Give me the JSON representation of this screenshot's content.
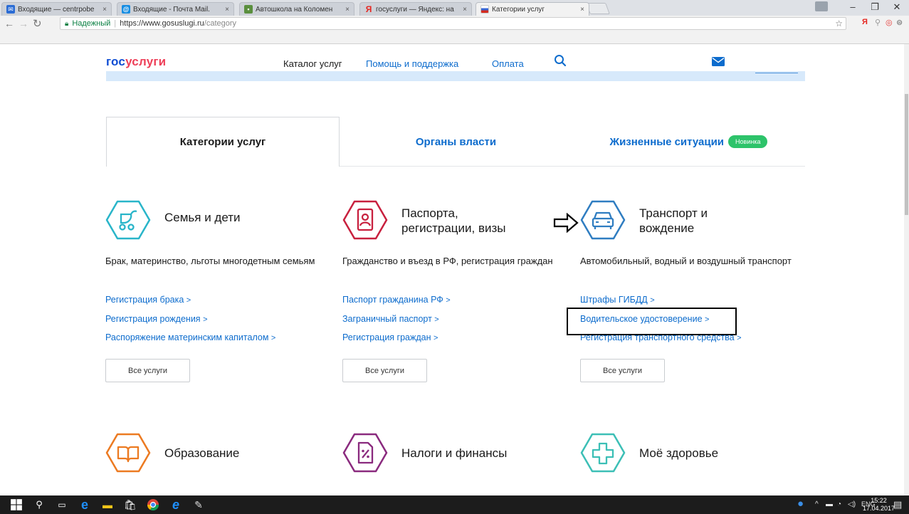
{
  "browser": {
    "tabs": [
      {
        "title": "Входящие — centrpobe",
        "favicon_color": "#2b6cd4",
        "active": false
      },
      {
        "title": "Входящие - Почта Mail.",
        "favicon_color": "#168de2",
        "active": false
      },
      {
        "title": "Автошкола на Коломен",
        "favicon_color": "#5a8f3e",
        "active": false
      },
      {
        "title": "госуслуги — Яндекс: на",
        "favicon_color": "#e52620",
        "active": false
      },
      {
        "title": "Категории услуг",
        "favicon_color": "#3766d4",
        "active": true
      }
    ],
    "tab_close_glyph": "×",
    "window_controls": {
      "minimize": "–",
      "maximize": "❐",
      "close": "✕"
    },
    "address": {
      "secure_label": "Надежный",
      "url_host": "https://www.gosuslugi.ru",
      "url_path": "/category"
    },
    "extensions": [
      "Я",
      "⚲",
      "◎",
      "⊜"
    ]
  },
  "site": {
    "logo_part1": "гос",
    "logo_part2": "услуги",
    "nav": {
      "catalog": "Каталог услуг",
      "help": "Помощь и поддержка",
      "payment": "Оплата"
    }
  },
  "tabs": {
    "categories": "Категории услуг",
    "authorities": "Органы власти",
    "life_situations": "Жизненные ситуации",
    "new_badge": "Новинка"
  },
  "categories": [
    {
      "title_line1": "Семья и дети",
      "title_line2": "",
      "description": "Брак, материнство, льготы многодетным семьям",
      "links": [
        "Регистрация брака",
        "Регистрация рождения",
        "Распоряжение материнским капиталом"
      ],
      "all_label": "Все услуги",
      "color": "#29b5c9"
    },
    {
      "title_line1": "Паспорта,",
      "title_line2": "регистрации, визы",
      "description": "Гражданство и въезд в РФ, регистрация граждан",
      "links": [
        "Паспорт гражданина РФ",
        "Заграничный паспорт",
        "Регистрация граждан"
      ],
      "all_label": "Все услуги",
      "color": "#c8203e"
    },
    {
      "title_line1": "Транспорт и",
      "title_line2": "вождение",
      "description": "Автомобильный, водный и воздушный транспорт",
      "links": [
        "Штрафы ГИБДД",
        "Водительское удостоверение",
        "Регистрация транспортного средства"
      ],
      "all_label": "Все услуги",
      "color": "#2f7dc1"
    }
  ],
  "categories_row2": [
    {
      "title": "Образование",
      "color": "#ec7a21"
    },
    {
      "title": "Налоги и финансы",
      "color": "#8a2a7e"
    },
    {
      "title": "Моё здоровье",
      "color": "#3cbfb6"
    }
  ],
  "link_chevron": ">",
  "taskbar": {
    "lang": "ENG",
    "time": "15:22",
    "date": "17.04.2017"
  }
}
